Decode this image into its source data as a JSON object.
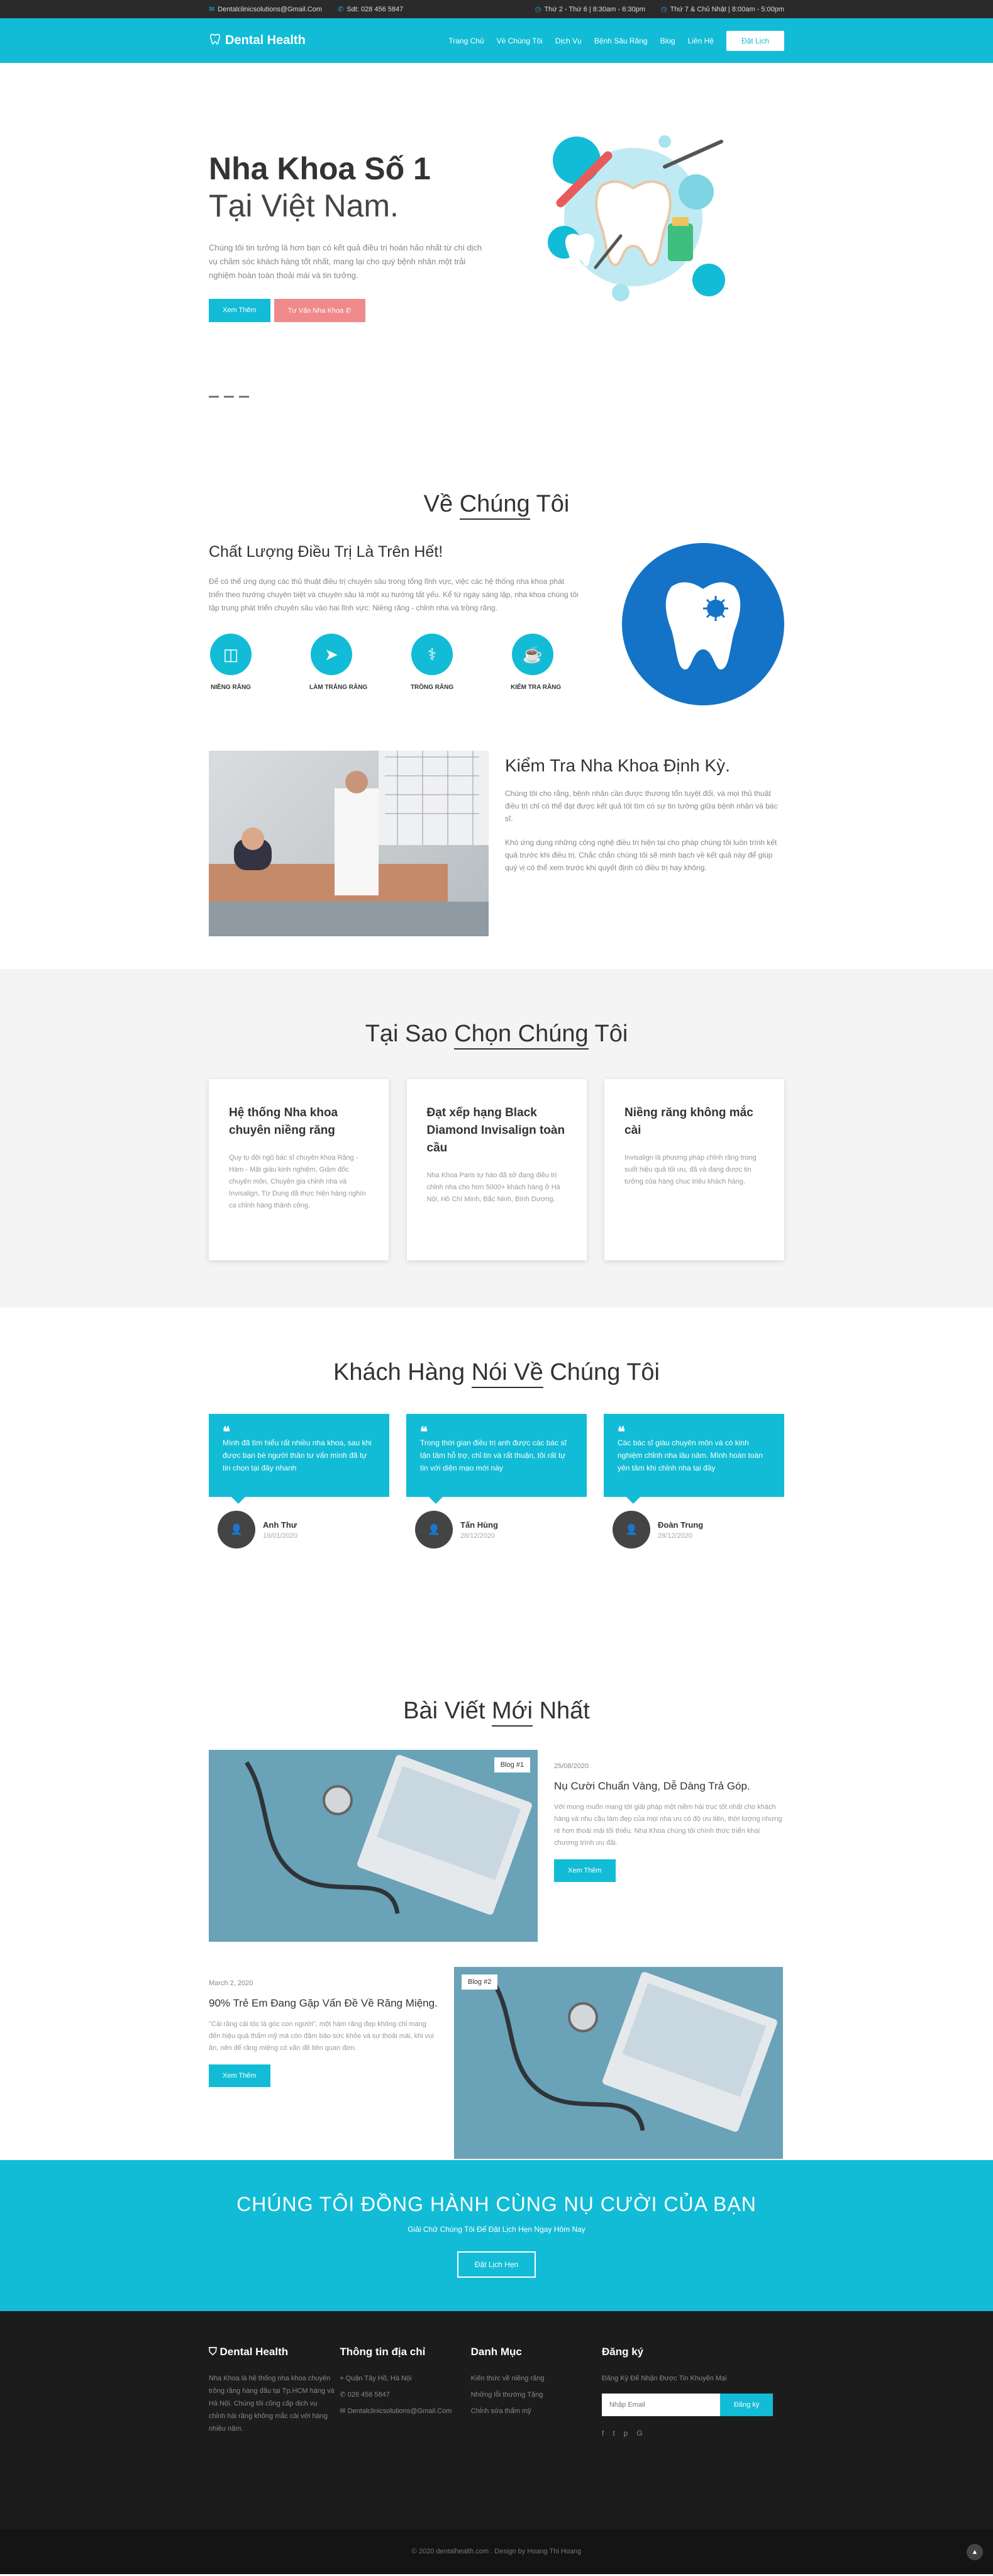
{
  "topbar": {
    "email": "Dentalclinicsolutions@Gmail.Com",
    "phone": "Sdt: 028 456 5847",
    "hours1": "Thứ 2 - Thứ 6 | 8:30am - 6:30pm",
    "hours2": "Thứ 7 & Chủ Nhật | 8:00am - 5:00pm"
  },
  "nav": {
    "brand": "Dental Health",
    "items": [
      "Trang Chủ",
      "Về Chúng Tôi",
      "Dịch Vụ",
      "Bệnh Sâu Răng",
      "Blog",
      "Liên Hệ"
    ],
    "book": "Đặt Lịch"
  },
  "hero": {
    "title1": "Nha Khoa Số 1",
    "title2": "Tại Việt Nam.",
    "text": "Chúng tôi tin tưởng là hơn bạn có kết quả điều trị hoàn hảo nhất từ chi dịch vụ chăm sóc khách hàng tốt nhất, mang lại cho quý bệnh nhân một trải nghiệm hoàn toàn thoải mái và tin tưởng.",
    "btn1": "Xem Thêm",
    "btn2": "Tư Vấn Nha Khoa ✆"
  },
  "about": {
    "title_a": "Về",
    "title_b": "Chúng",
    "title_c": "Tôi",
    "heading": "Chất Lượng Điều Trị Là Trên Hết!",
    "text": "Để có thể ứng dụng các thủ thuật điều trị chuyên sâu trong tổng lĩnh vực, việc các hệ thống nha khoa phát triển theo hướng chuyên biệt và chuyên sâu là một xu hướng tất yếu. Kể từ ngày sáng lập, nha khoa chúng tôi tập trung phát triển chuyên sâu vào hai lĩnh vực: Niềng răng - chỉnh nha và trồng răng.",
    "features": [
      "NIỀNG RĂNG",
      "LÀM TRẮNG RĂNG",
      "TRỒNG RĂNG",
      "KIỂM TRA RĂNG"
    ],
    "checkup_title": "Kiểm Tra Nha Khoa Định Kỳ.",
    "checkup_p1": "Chúng tôi cho rằng, bệnh nhân cần được thương tổn tuyệt đối, và mọi thủ thuật điều trị chỉ có thể đạt được kết quả tốt tìm có sự tin tưởng giữa bệnh nhân và bác sĩ.",
    "checkup_p2": "Khó ứng dụng những công nghệ điều trị hiện tại cho pháp chúng tôi luôn trình kết quả trước khi điều trị. Chắc chắn chúng tôi sẽ minh bạch về kết quả này để giúp quý vị có thể xem trước khi quyết định có điều trị hay không."
  },
  "why": {
    "title_a": "Tại Sao",
    "title_b": "Chọn Chúng",
    "title_c": "Tôi",
    "cards": [
      {
        "title": "Hệ thống Nha khoa chuyên niềng răng",
        "text": "Quy tụ đội ngũ bác sĩ chuyên khoa Răng - Hàm - Mặt giàu kinh nghiệm, Giảm đốc chuyên môn, Chuyên gia chỉnh nha và Invisalign, Từ Dung đã thực hiện hàng nghìn ca chỉnh hàng thành công."
      },
      {
        "title": "Đạt xếp hạng Black Diamond Invisalign toàn cầu",
        "text": "Nha Khoa Paris tự hào đã sở đạng điều trị chỉnh nha cho hơn 5000+ khách hàng ở Hà Nội, Hồ Chí Minh, Bắc Ninh, Bình Dương."
      },
      {
        "title": "Niềng răng không mắc cài",
        "text": "Invisalign là phương pháp chỉnh răng trong suốt hiệu quả tối ưu, đã và đang được tin tưởng của hàng chục triệu khách hàng."
      }
    ]
  },
  "testimonials": {
    "title_a": "Khách Hàng",
    "title_b": "Nói Về",
    "title_c": "Chúng Tôi",
    "items": [
      {
        "text": "Mình đã tìm hiểu rất nhiều nha khoa, sau khi được bạn bè người thân tư vấn mình đã tự tin chọn tại đây nhanh",
        "name": "Anh Thư",
        "date": "18/01/2020"
      },
      {
        "text": "Trong thời gian điều trị anh được các bác sĩ tận tâm hỗ trợ, chỉ tin và rất thuận, tôi rất tự tin với diện mạo mới này",
        "name": "Tấn Hùng",
        "date": "28/12/2020"
      },
      {
        "text": "Các bác sĩ giàu chuyên môn và có kinh nghiệm chỉnh nha lâu năm. Mình hoàn toàn yên tâm khi chỉnh nha tại đây",
        "name": "Đoàn Trung",
        "date": "28/12/2020"
      }
    ]
  },
  "blog": {
    "title_a": "Bài Viết",
    "title_b": "Mới",
    "title_c": "Nhất",
    "posts": [
      {
        "tag": "Blog #1",
        "date": "25/08/2020",
        "title": "Nụ Cười Chuẩn Vàng, Dễ Dàng Trả Góp.",
        "text": "Với mong muốn mang tới giải pháp một niềm hài trục tốt nhất cho khách hàng và nhu cầu làm đẹp của mọi nha ưu có độ ưu tiên, thời lượng nhưng rẻ hơn thoải mái tối thiểu. Nha Khoa chúng tôi chính thức triển khai chương trình ưu đãi.",
        "btn": "Xem Thêm"
      },
      {
        "tag": "Blog #2",
        "date": "March 2, 2020",
        "title": "90% Trẻ Em Đang Gặp Vấn Đề Về Răng Miệng.",
        "text": "\"Cái răng cái tóc là góc con người\", một hàm răng đẹp không chỉ mang đến hiệu quả thẩm mỹ mà còn đảm bảo sức khỏe và sự thoải mái, khi vui ăn, nên để răng miệng có vấn đề tiên quan đơn.",
        "btn": "Xem Thêm"
      }
    ]
  },
  "cta": {
    "title": "CHÚNG TÔI ĐỒNG HÀNH CÙNG NỤ CƯỜI CỦA BẠN",
    "subtitle": "Giải Chữ Chúng Tôi Để Đặt Lịch Hẹn Ngay Hôm Nay",
    "btn": "Đặt Lịch Hẹn"
  },
  "footer": {
    "brand": "Dental Health",
    "about": "Nha Khoa là hệ thống nha khoa chuyên trồng răng hàng đầu tại Tp.HCM hàng và Hà Nội. Chúng tôi cũng cấp dịch vụ chỉnh hài răng không mắc cài với hàng nhiều năm.",
    "addr_title": "Thông tin địa chỉ",
    "address": "Quận Tây Hồ, Hà Nội",
    "phone": "028 456 5847",
    "email": "Dentalclinicsolutions@Gmail.Com",
    "cat_title": "Danh Mục",
    "cats": [
      "Kiến thức về niềng răng",
      "Những lỗi thường Tặng",
      "Chỉnh sửa thẩm mỹ"
    ],
    "sub_title": "Đăng ký",
    "sub_text": "Đăng Ký Để Nhận Được Tin Khuyến Mại",
    "sub_placeholder": "Nhập Email",
    "sub_btn": "Đăng ký",
    "copyright": "© 2020 dentalhealth.com . Design by Hoang Thi Hoang"
  },
  "colors": {
    "accent": "#12bcd6",
    "dark": "#1c1c1c",
    "pink": "#f08a8a",
    "tooth_bg": "#1473c6"
  }
}
